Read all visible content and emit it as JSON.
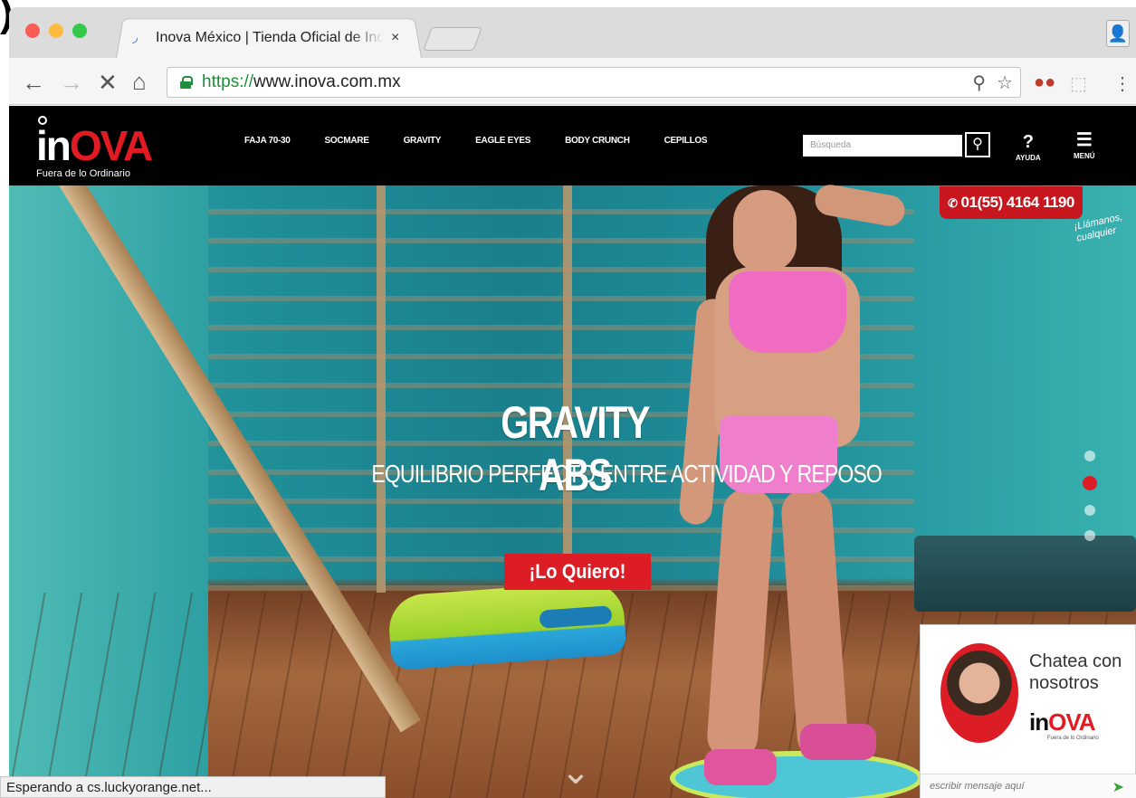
{
  "browser": {
    "tab_title": "Inova México | Tienda Oficial de Inova",
    "tab_close": "×",
    "url_scheme": "https://",
    "url_host": "www.inova.com.mx",
    "status_text": "Esperando a cs.luckyorange.net..."
  },
  "site": {
    "logo_in": "in",
    "logo_ova": "OVA",
    "logo_tagline": "Fuera de lo Ordinario",
    "nav": [
      "FAJA 70-30",
      "SOCMARE",
      "GRAVITY",
      "EAGLE EYES",
      "BODY CRUNCH",
      "CEPILLOS"
    ],
    "search_placeholder": "Búsqueda",
    "help_label": "AYUDA",
    "menu_label": "MENÚ",
    "phone": "01(55) 4164 1190",
    "phone_note": "¡Llámanos, cualquier"
  },
  "hero": {
    "title": "GRAVITY ABS",
    "subtitle": "EQUILIBRIO PERFECTO ENTRE ACTIVIDAD Y REPOSO",
    "cta": "¡Lo Quiero!",
    "slide_count": 4,
    "active_slide": 2
  },
  "chat": {
    "heading_line1": "Chatea con",
    "heading_line2": "nosotros",
    "logo_in": "in",
    "logo_ova": "OVA",
    "tagline": "Fuera de lo Ordinario",
    "input_placeholder": "escribir mensaje aquí"
  },
  "colors": {
    "brand_red": "#dc1d25",
    "header_black": "#000000",
    "secure_green": "#1f8e3a"
  }
}
